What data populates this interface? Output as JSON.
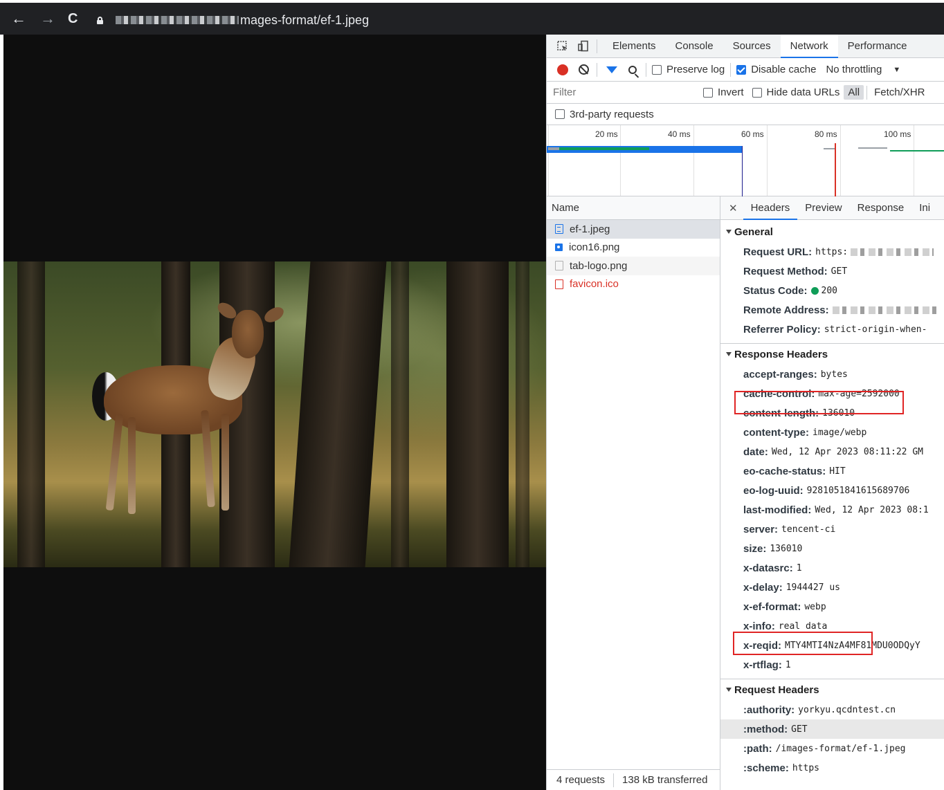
{
  "browser": {
    "url_suffix": "mages-format/ef-1.jpeg"
  },
  "devtools": {
    "tabs": [
      "Elements",
      "Console",
      "Sources",
      "Network",
      "Performance"
    ],
    "active_tab": "Network",
    "toolbar": {
      "preserve_log": "Preserve log",
      "disable_cache": "Disable cache",
      "throttling": "No throttling"
    },
    "filter": {
      "placeholder": "Filter",
      "invert": "Invert",
      "hide_data_urls": "Hide data URLs",
      "all": "All",
      "fetch_xhr": "Fetch/XHR",
      "third_party": "3rd-party requests"
    },
    "timeline_ticks": [
      "20 ms",
      "40 ms",
      "60 ms",
      "80 ms",
      "100 ms"
    ],
    "name_header": "Name",
    "requests": [
      {
        "name": "ef-1.jpeg",
        "icon": "document-icon"
      },
      {
        "name": "icon16.png",
        "icon": "image-icon"
      },
      {
        "name": "tab-logo.png",
        "icon": "file-icon"
      },
      {
        "name": "favicon.ico",
        "icon": "error-file-icon"
      }
    ],
    "summary": {
      "requests": "4 requests",
      "transferred": "138 kB transferred"
    },
    "detail_tabs": [
      "Headers",
      "Preview",
      "Response",
      "Ini"
    ],
    "general": {
      "title": "General",
      "rows": [
        {
          "k": "Request URL:",
          "v": "https:"
        },
        {
          "k": "Request Method:",
          "v": "GET"
        },
        {
          "k": "Status Code:",
          "v": "200"
        },
        {
          "k": "Remote Address:",
          "v": ""
        },
        {
          "k": "Referrer Policy:",
          "v": "strict-origin-when-"
        }
      ]
    },
    "response_headers": {
      "title": "Response Headers",
      "rows": [
        {
          "k": "accept-ranges:",
          "v": "bytes"
        },
        {
          "k": "cache-control:",
          "v": "max-age=2592000"
        },
        {
          "k": "content-length:",
          "v": "136010"
        },
        {
          "k": "content-type:",
          "v": "image/webp"
        },
        {
          "k": "date:",
          "v": "Wed, 12 Apr 2023 08:11:22 GM"
        },
        {
          "k": "eo-cache-status:",
          "v": "HIT"
        },
        {
          "k": "eo-log-uuid:",
          "v": "9281051841615689706"
        },
        {
          "k": "last-modified:",
          "v": "Wed, 12 Apr 2023 08:1"
        },
        {
          "k": "server:",
          "v": "tencent-ci"
        },
        {
          "k": "size:",
          "v": "136010"
        },
        {
          "k": "x-datasrc:",
          "v": "1"
        },
        {
          "k": "x-delay:",
          "v": "1944427 us"
        },
        {
          "k": "x-ef-format:",
          "v": "webp"
        },
        {
          "k": "x-info:",
          "v": "real data"
        },
        {
          "k": "x-reqid:",
          "v": "MTY4MTI4NzA4MF81MDU0ODQyY"
        },
        {
          "k": "x-rtflag:",
          "v": "1"
        }
      ]
    },
    "request_headers": {
      "title": "Request Headers",
      "rows": [
        {
          "k": ":authority:",
          "v": "yorkyu.qcdntest.cn"
        },
        {
          "k": ":method:",
          "v": "GET"
        },
        {
          "k": ":path:",
          "v": "/images-format/ef-1.jpeg"
        },
        {
          "k": ":scheme:",
          "v": "https"
        }
      ]
    }
  }
}
